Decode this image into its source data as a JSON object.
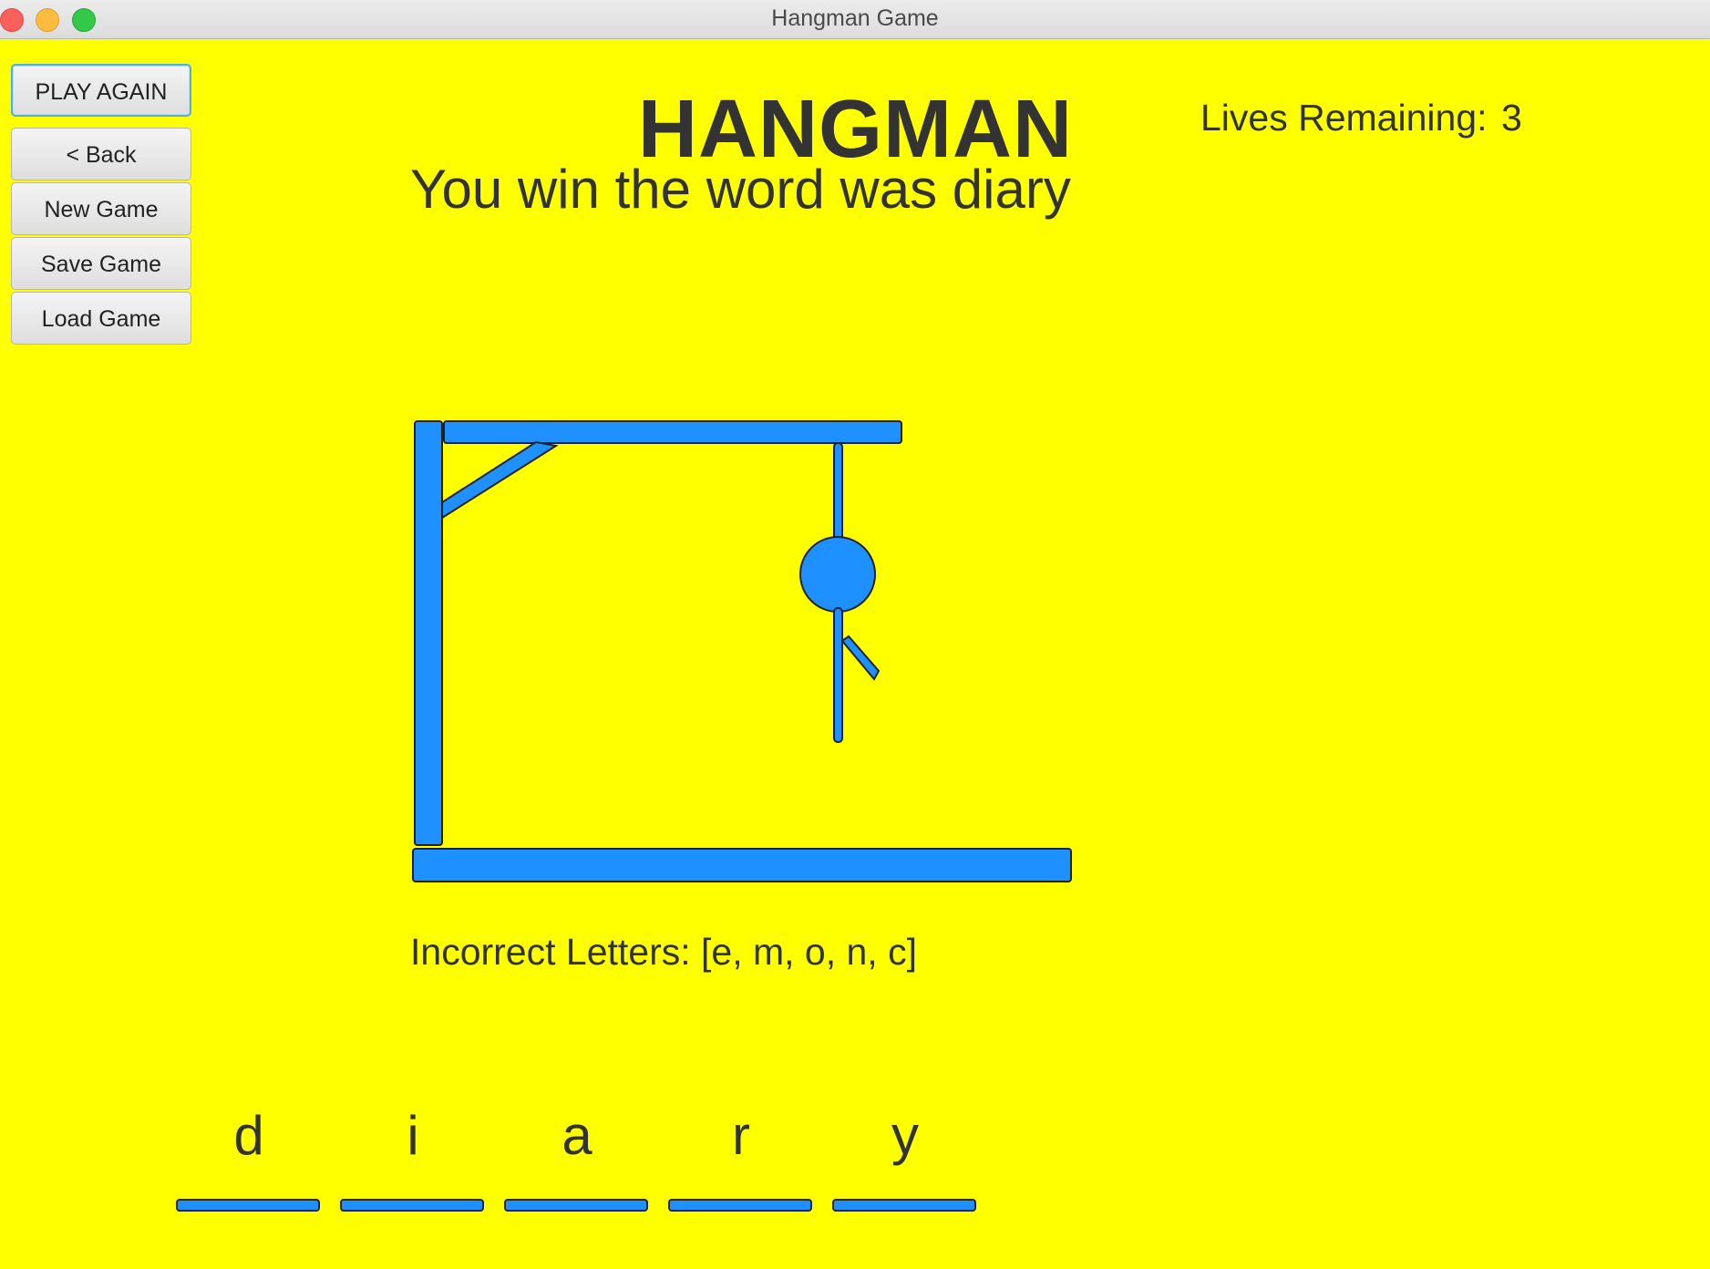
{
  "window": {
    "title": "Hangman Game"
  },
  "sidebar": {
    "buttons": [
      {
        "label": "PLAY AGAIN"
      },
      {
        "label": "< Back"
      },
      {
        "label": "New Game"
      },
      {
        "label": "Save Game"
      },
      {
        "label": "Load Game"
      }
    ]
  },
  "header": {
    "title": "HANGMAN",
    "message": "You win the word was diary",
    "lives_label": "Lives Remaining:",
    "lives_value": "3"
  },
  "game": {
    "incorrect_letters": "Incorrect Letters: [e, m, o, n, c]",
    "word_letters": [
      "d",
      "i",
      "a",
      "r",
      "y"
    ],
    "figure_parts_shown": [
      "rope",
      "head",
      "body",
      "right-arm"
    ]
  },
  "colors": {
    "background": "#ffff00",
    "accent": "#1e90ff",
    "text": "#333333"
  }
}
